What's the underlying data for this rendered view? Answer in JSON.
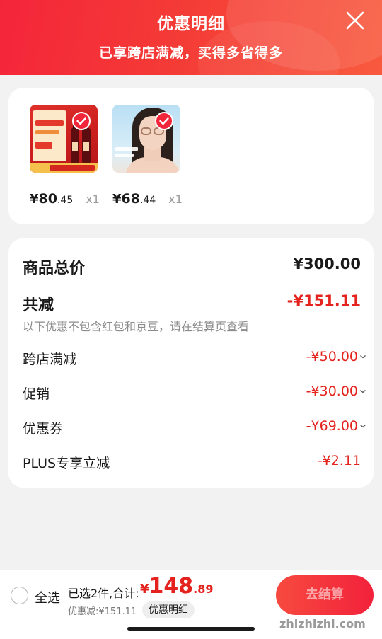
{
  "header": {
    "title": "优惠明细",
    "subtitle": "已享跨店满减，买得多省得多"
  },
  "products": [
    {
      "price_currency": "¥",
      "price_int": "80",
      "price_dec": ".45",
      "qty": "x1",
      "selected": true
    },
    {
      "price_currency": "¥",
      "price_int": "68",
      "price_dec": ".44",
      "qty": "x1",
      "selected": true
    }
  ],
  "summary": {
    "total_label": "商品总价",
    "total_value": "¥300.00",
    "reduce_label": "共减",
    "reduce_value": "-¥151.11",
    "note": "以下优惠不包含红包和京豆，请在结算页查看",
    "items": [
      {
        "label": "跨店满减",
        "value": "-¥50.00"
      },
      {
        "label": "促销",
        "value": "-¥30.00"
      },
      {
        "label": "优惠券",
        "value": "-¥69.00"
      },
      {
        "label": "PLUS专享立减",
        "value": "-¥2.11"
      }
    ]
  },
  "bottom": {
    "select_all": "全选",
    "selected_text": "已选2件,合计:",
    "total_currency": "¥",
    "total_int": "148",
    "total_dec": ".89",
    "saved_text": "优惠减:¥151.11",
    "detail_chip": "优惠明细",
    "checkout_label": "去结算"
  },
  "watermark": "zhizhizhi.com",
  "colors": {
    "accent_red": "#e4231f",
    "header_red": "#f4253a"
  }
}
